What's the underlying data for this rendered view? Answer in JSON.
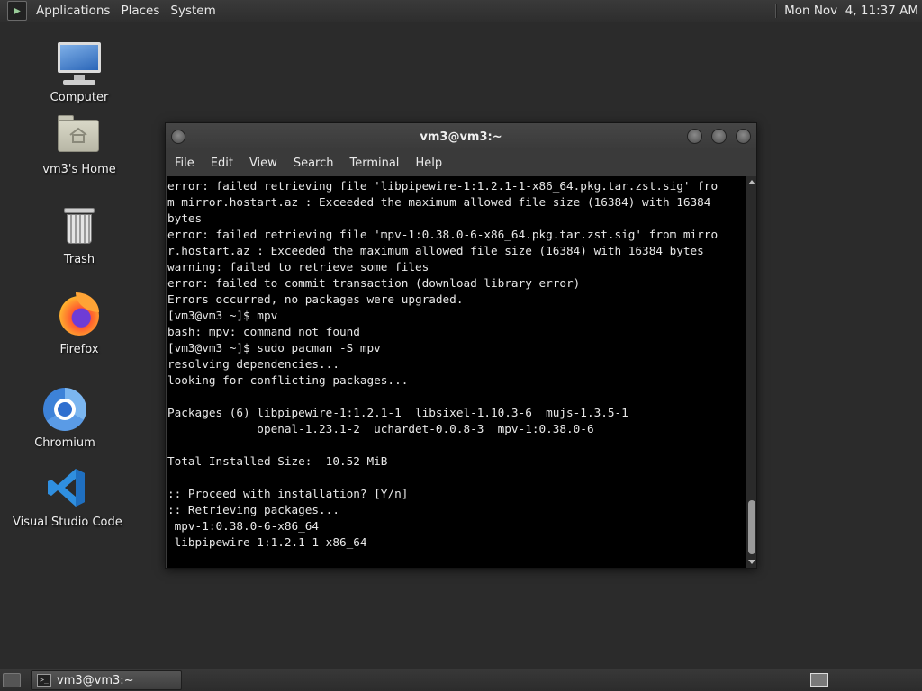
{
  "top_panel": {
    "menus": [
      "Applications",
      "Places",
      "System"
    ],
    "clock": "Mon Nov  4, 11:37 AM"
  },
  "desktop_icons": [
    {
      "label": "Computer",
      "icon": "computer-icon"
    },
    {
      "label": "vm3's Home",
      "icon": "home-folder-icon"
    },
    {
      "label": "Trash",
      "icon": "trash-icon"
    },
    {
      "label": "Firefox",
      "icon": "firefox-icon"
    },
    {
      "label": "Chromium",
      "icon": "chromium-icon"
    },
    {
      "label": "Visual Studio Code",
      "icon": "vscode-icon"
    }
  ],
  "window": {
    "title": "vm3@vm3:~",
    "menu": [
      "File",
      "Edit",
      "View",
      "Search",
      "Terminal",
      "Help"
    ]
  },
  "terminal": {
    "lines": [
      "error: failed retrieving file 'libpipewire-1:1.2.1-1-x86_64.pkg.tar.zst.sig' fro",
      "m mirror.hostart.az : Exceeded the maximum allowed file size (16384) with 16384",
      "bytes",
      "error: failed retrieving file 'mpv-1:0.38.0-6-x86_64.pkg.tar.zst.sig' from mirro",
      "r.hostart.az : Exceeded the maximum allowed file size (16384) with 16384 bytes",
      "warning: failed to retrieve some files",
      "error: failed to commit transaction (download library error)",
      "Errors occurred, no packages were upgraded.",
      "[vm3@vm3 ~]$ mpv",
      "bash: mpv: command not found",
      "[vm3@vm3 ~]$ sudo pacman -S mpv",
      "resolving dependencies...",
      "looking for conflicting packages...",
      "",
      "Packages (6) libpipewire-1:1.2.1-1  libsixel-1.10.3-6  mujs-1.3.5-1",
      "             openal-1.23.1-2  uchardet-0.0.8-3  mpv-1:0.38.0-6",
      "",
      "Total Installed Size:  10.52 MiB",
      "",
      ":: Proceed with installation? [Y/n]",
      ":: Retrieving packages...",
      " mpv-1:0.38.0-6-x86_64",
      " libpipewire-1:1.2.1-1-x86_64"
    ]
  },
  "taskbar": {
    "task_label": "vm3@vm3:~"
  }
}
